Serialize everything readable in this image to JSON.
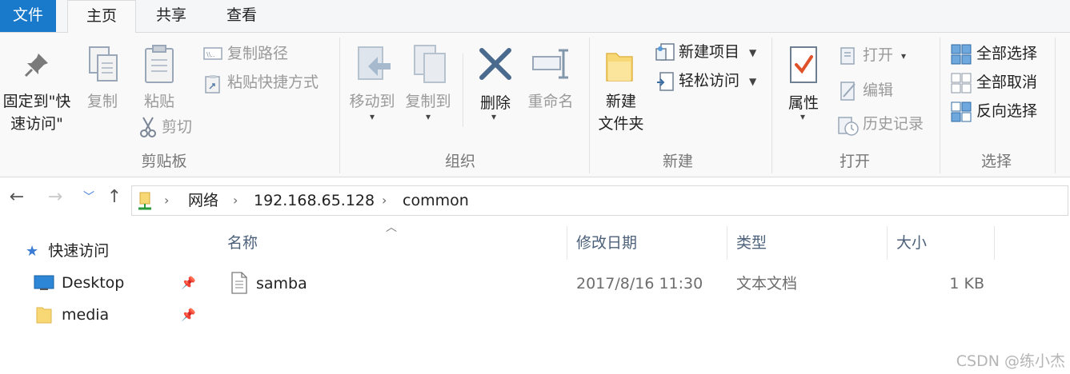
{
  "tabs": {
    "file": "文件",
    "home": "主页",
    "share": "共享",
    "view": "查看"
  },
  "ribbon": {
    "clipboard": {
      "label": "剪贴板",
      "pin_line1": "固定到\"快",
      "pin_line2": "速访问\"",
      "copy": "复制",
      "paste": "粘贴",
      "copy_path": "复制路径",
      "paste_shortcut": "粘贴快捷方式",
      "cut": "剪切"
    },
    "organize": {
      "label": "组织",
      "move_to": "移动到",
      "copy_to": "复制到",
      "delete": "删除",
      "rename": "重命名"
    },
    "new": {
      "label": "新建",
      "new_folder_line1": "新建",
      "new_folder_line2": "文件夹",
      "new_item": "新建项目",
      "easy_access": "轻松访问"
    },
    "open": {
      "label": "打开",
      "properties": "属性",
      "open": "打开",
      "edit": "编辑",
      "history": "历史记录"
    },
    "select": {
      "label": "选择",
      "select_all": "全部选择",
      "select_none": "全部取消",
      "invert": "反向选择"
    }
  },
  "address": {
    "crumbs": [
      "网络",
      "192.168.65.128",
      "common"
    ]
  },
  "navpane": {
    "quick_access": "快速访问",
    "items": [
      {
        "label": "Desktop",
        "icon": "desktop-icon"
      },
      {
        "label": "media",
        "icon": "folder-icon"
      }
    ]
  },
  "filelist": {
    "columns": [
      "名称",
      "修改日期",
      "类型",
      "大小"
    ],
    "rows": [
      {
        "name": "samba",
        "modified": "2017/8/16 11:30",
        "type": "文本文档",
        "size": "1 KB"
      }
    ]
  },
  "watermark": "CSDN @练小杰",
  "colors": {
    "accent": "#1979ca",
    "folder": "#f8d775",
    "disabled": "#9a9a9a"
  }
}
